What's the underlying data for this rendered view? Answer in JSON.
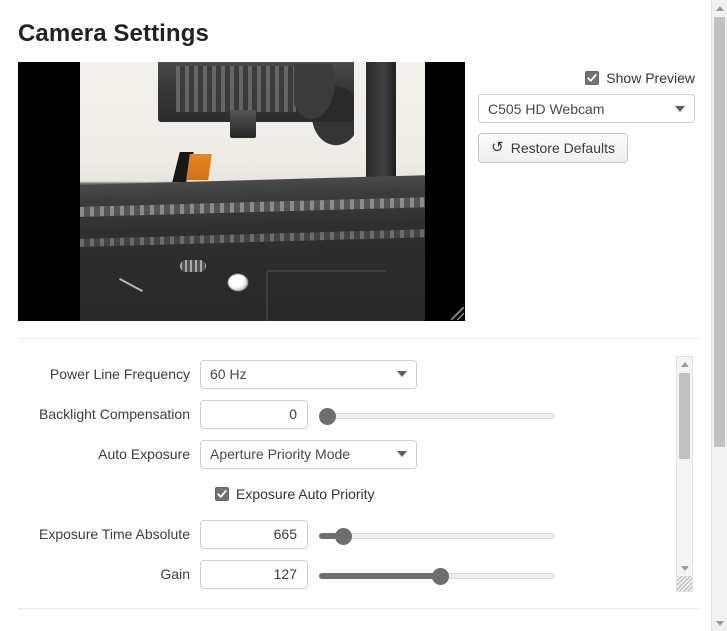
{
  "page": {
    "title": "Camera Settings"
  },
  "preview": {
    "show_preview_label": "Show Preview",
    "show_preview_checked": true,
    "checkbox_icon": "check-icon",
    "device_selected": "C505 HD Webcam",
    "device_caret_icon": "chevron-down-icon",
    "restore_defaults_label": "Restore Defaults",
    "restore_icon": "undo-arrow-icon",
    "restore_glyph": "↺",
    "video_resize_grip_icon": "resize-grip-icon"
  },
  "settings": [
    {
      "label": "Power Line Frequency",
      "type": "select",
      "value": "60 Hz",
      "caret_icon": "chevron-down-icon"
    },
    {
      "label": "Backlight Compensation",
      "type": "number-slider",
      "value": "0",
      "slider_percent": 0
    },
    {
      "label": "Auto Exposure",
      "type": "select",
      "value": "Aperture Priority Mode",
      "caret_icon": "chevron-down-icon"
    },
    {
      "label": "Exposure Auto Priority",
      "type": "checkbox",
      "checked": true,
      "checkbox_icon": "check-icon"
    },
    {
      "label": "Exposure Time Absolute",
      "type": "number-slider",
      "value": "665",
      "slider_percent": 10
    },
    {
      "label": "Gain",
      "type": "number-slider",
      "value": "127",
      "slider_percent": 50
    }
  ],
  "scrollbars": {
    "page": {
      "up_icon": "scroll-up-arrow-icon",
      "down_icon": "scroll-down-arrow-icon",
      "thumb_top_percent": 3,
      "thumb_height_percent": 68
    },
    "panel": {
      "up_icon": "scroll-up-arrow-icon",
      "down_icon": "scroll-down-arrow-icon",
      "resize_grip_icon": "resize-grip-icon",
      "thumb_top_percent": 7,
      "thumb_height_percent": 36
    }
  },
  "colors": {
    "accent": "#6f7276",
    "slider_fill": "#6e6e6e",
    "border": "#cfcfcf",
    "text": "#3d3d3d",
    "divider": "#e8e8e8",
    "scrollbar_thumb": "#c1c1c1"
  }
}
